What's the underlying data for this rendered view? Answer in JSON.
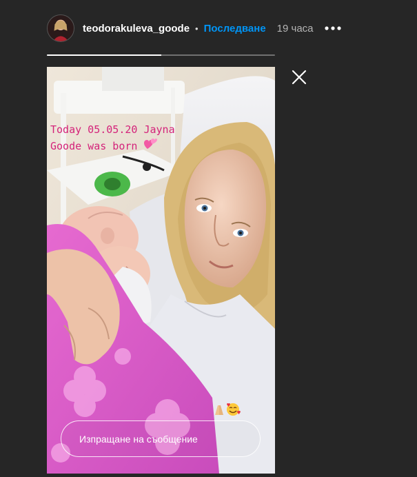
{
  "header": {
    "username": "teodorakuleva_goode",
    "separator": "•",
    "follow_label": "Последване",
    "time_ago": "19 часа"
  },
  "icons": {
    "more": "more-horizontal-icon",
    "close": "close-icon",
    "avatar": "avatar"
  },
  "progress": {
    "current_story_fraction": 0.5
  },
  "story": {
    "caption_line1": "Today 05.05.20 Jayna",
    "caption_line2": "Goode was born ",
    "reply_placeholder": "Изпращане на съобщение"
  },
  "colors": {
    "background": "#262626",
    "follow": "#0095f6",
    "caption": "#d4237a"
  }
}
